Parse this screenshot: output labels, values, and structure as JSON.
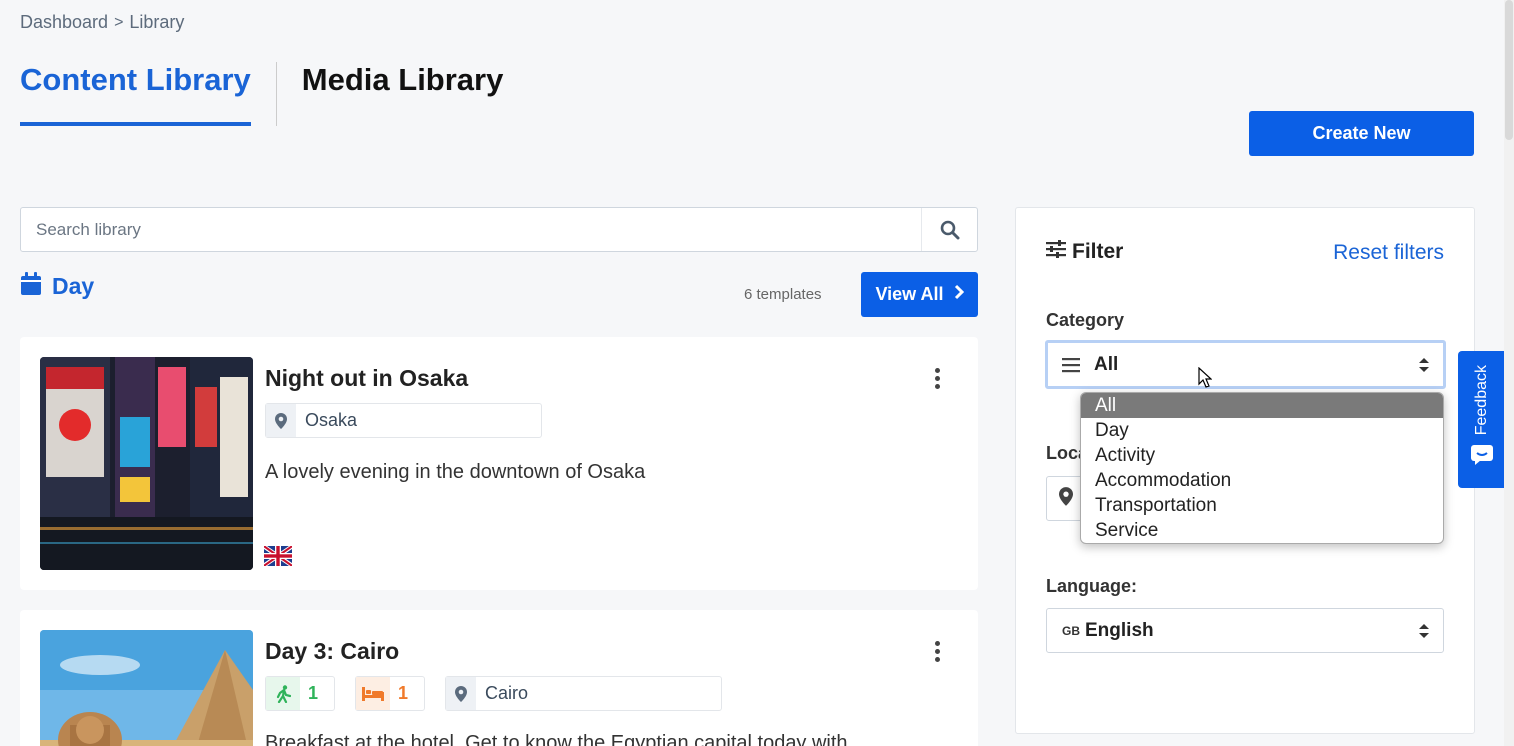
{
  "breadcrumb": {
    "items": [
      "Dashboard",
      "Library"
    ],
    "separator": ">"
  },
  "tabs": [
    {
      "label": "Content Library",
      "active": true
    },
    {
      "label": "Media Library",
      "active": false
    }
  ],
  "create_button": {
    "label": "Create New"
  },
  "search": {
    "placeholder": "Search library",
    "value": ""
  },
  "section": {
    "title": "Day",
    "count_text": "6 templates",
    "view_all_label": "View All"
  },
  "cards": [
    {
      "title": "Night out in Osaka",
      "location": "Osaka",
      "description": "A lovely evening in the downtown of Osaka",
      "flag": "uk-flag-icon"
    },
    {
      "title": "Day 3: Cairo",
      "activity_count": "1",
      "accommodation_count": "1",
      "location": "Cairo",
      "description": "Breakfast at the hotel. Get to know the Egyptian capital today with"
    }
  ],
  "filter": {
    "title": "Filter",
    "reset_label": "Reset filters",
    "category_label": "Category",
    "category_value": "All",
    "category_options": [
      "All",
      "Day",
      "Activity",
      "Accommodation",
      "Transportation",
      "Service"
    ],
    "location_label_partial": "Loca",
    "language_label": "Language:",
    "language_code": "GB",
    "language_value": "English"
  },
  "feedback": {
    "label": "Feedback"
  },
  "colors": {
    "accent": "#0b5fe6",
    "link": "#1a64d6",
    "activity": "#2fb35a",
    "accommodation": "#f07a2b"
  }
}
